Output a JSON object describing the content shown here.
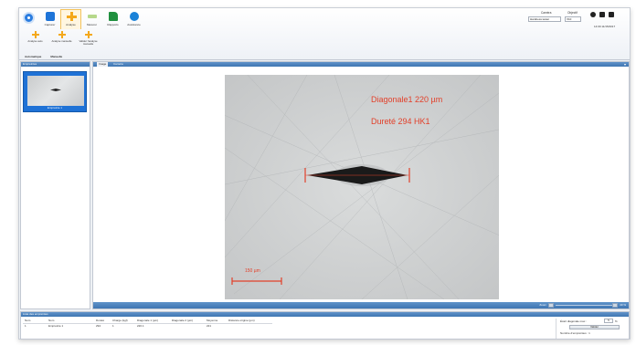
{
  "ribbon": {
    "tabs": [
      {
        "label": "Capturer",
        "icon": "camera-icon"
      },
      {
        "label": "Analyse",
        "icon": "crosshair-icon"
      },
      {
        "label": "Mesurer",
        "icon": "ruler-icon"
      },
      {
        "label": "Rapports",
        "icon": "report-icon"
      },
      {
        "label": "Assistance",
        "icon": "help-bubble-icon"
      }
    ],
    "sub_buttons": [
      {
        "label": "Analyse auto"
      },
      {
        "label": "Analyse manuelle"
      },
      {
        "label": "Valider l'analyse manuelle"
      }
    ],
    "groups": [
      "Automatique",
      "Manuelle"
    ]
  },
  "top_right": {
    "camera_label": "Caméra",
    "camera_value": "Hardness tester",
    "objective_label": "Objectif",
    "objective_value": "X10",
    "datetime": "14:09 11/15/2017"
  },
  "left_panel": {
    "title": "Empreintes",
    "thumbnail_label": "Empreinte 1"
  },
  "view": {
    "tabs": [
      "Image",
      "Caméra"
    ],
    "annotation_line1": "Diagonale1 220 µm",
    "annotation_line2": "Dureté 294 HK1",
    "scale_bar_label": "150 µm",
    "zoom_label": "Zoom",
    "zoom_value": "40 %",
    "zoom_fraction": 0.4
  },
  "bottom": {
    "title": "Liste des empreintes",
    "columns": [
      "Num",
      "Nom",
      "Dureté",
      "Charge (kgf)",
      "Diagonale 1 (µm)",
      "Diagonale 2 (µm)",
      "Moyenne",
      "Distance origine (µm)"
    ],
    "rows": [
      [
        "1",
        "Empreinte 1",
        "294",
        "1",
        "220.1",
        "",
        "221",
        ""
      ]
    ],
    "ecart_label": "Écart diagonale max :",
    "ecart_value": "5",
    "ecart_unit": "%",
    "validate_label": "Valider",
    "count_label": "Nombre d'empreintes : 1"
  },
  "colors": {
    "accent": "#3f76b2",
    "annotation": "#e2402a",
    "selection": "#1f72d6"
  }
}
